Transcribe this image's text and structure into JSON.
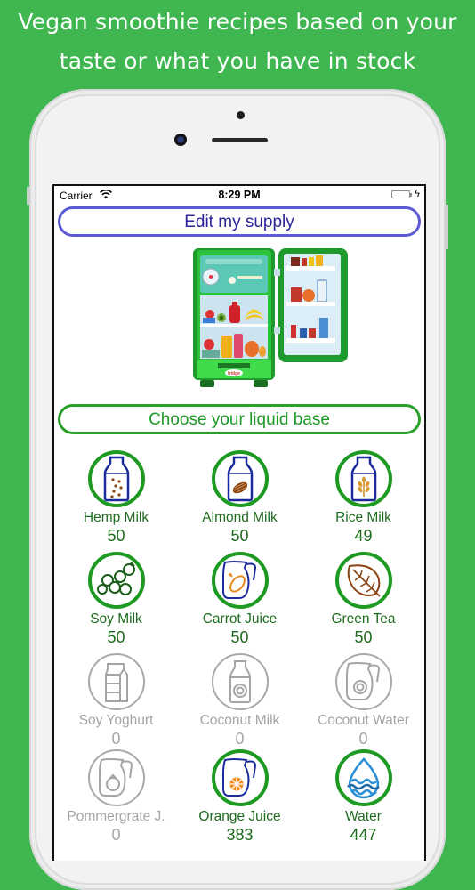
{
  "promo": {
    "line1": "Vegan smoothie recipes based on your",
    "line2": "taste or what you have in stock"
  },
  "status_bar": {
    "carrier": "Carrier",
    "time": "8:29 PM",
    "battery_charging": true
  },
  "actions": {
    "edit_supply": "Edit my supply",
    "choose_base": "Choose your liquid base"
  },
  "illustration": {
    "fridge_label": "fridge"
  },
  "colors": {
    "background": "#3fb650",
    "active_ring": "#1e9a23",
    "inactive": "#a9a9a9",
    "edit_border": "#5c5bd3",
    "label_green": "#1f6b1f"
  },
  "liquid_bases": [
    {
      "name": "Hemp Milk",
      "count": "50",
      "icon": "milk-bottle-seeds-icon",
      "available": true
    },
    {
      "name": "Almond Milk",
      "count": "50",
      "icon": "milk-bottle-almond-icon",
      "available": true
    },
    {
      "name": "Rice Milk",
      "count": "49",
      "icon": "milk-bottle-wheat-icon",
      "available": true
    },
    {
      "name": "Soy Milk",
      "count": "50",
      "icon": "soybean-pod-icon",
      "available": true
    },
    {
      "name": "Carrot Juice",
      "count": "50",
      "icon": "jug-carrot-icon",
      "available": true
    },
    {
      "name": "Green Tea",
      "count": "50",
      "icon": "leaf-icon",
      "available": true
    },
    {
      "name": "Soy Yoghurt",
      "count": "0",
      "icon": "milk-carton-icon",
      "available": false
    },
    {
      "name": "Coconut Milk",
      "count": "0",
      "icon": "bottle-coconut-icon",
      "available": false
    },
    {
      "name": "Coconut Water",
      "count": "0",
      "icon": "jug-coconut-icon",
      "available": false
    },
    {
      "name": "Pommergrate J.",
      "count": "0",
      "icon": "jug-pomegranate-icon",
      "available": false
    },
    {
      "name": "Orange Juice",
      "count": "383",
      "icon": "jug-orange-icon",
      "available": true
    },
    {
      "name": "Water",
      "count": "447",
      "icon": "water-drop-icon",
      "available": true
    }
  ]
}
